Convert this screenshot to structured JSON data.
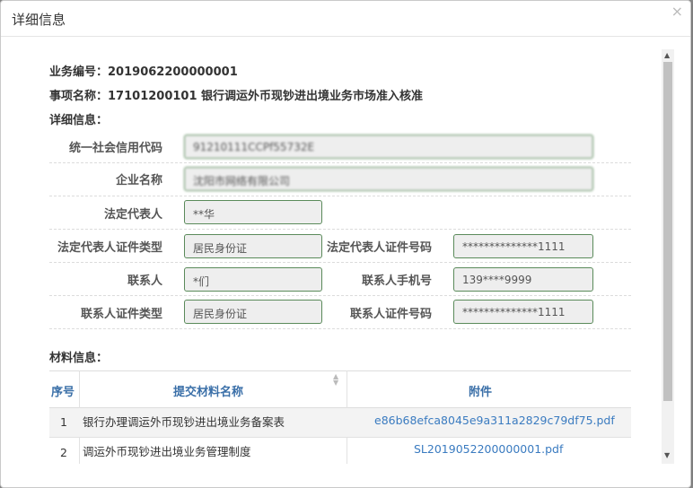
{
  "dialog": {
    "title": "详细信息",
    "close_glyph": "×"
  },
  "info": {
    "business_no_label": "业务编号：",
    "business_no": "2019062200000001",
    "item_name_label": "事项名称：",
    "item_name": "17101200101 银行调运外币现钞进出境业务市场准入核准",
    "details_label": "详细信息："
  },
  "form": {
    "credit_code_label": "统一社会信用代码",
    "credit_code_value": "91210111CCPf55732E",
    "company_name_label": "企业名称",
    "company_name_value": "沈阳市网络有限公司",
    "legal_rep_label": "法定代表人",
    "legal_rep_value": "**华",
    "legal_id_type_label": "法定代表人证件类型",
    "legal_id_type_value": "居民身份证",
    "legal_id_no_label": "法定代表人证件号码",
    "legal_id_no_value": "**************1111",
    "contact_label": "联系人",
    "contact_value": "*们",
    "contact_phone_label": "联系人手机号",
    "contact_phone_value": "139****9999",
    "contact_id_type_label": "联系人证件类型",
    "contact_id_type_value": "居民身份证",
    "contact_id_no_label": "联系人证件号码",
    "contact_id_no_value": "**************1111"
  },
  "materials": {
    "label": "材料信息：",
    "headers": {
      "seq": "序号",
      "name": "提交材料名称",
      "attachment": "附件"
    },
    "rows": [
      {
        "seq": "1",
        "name": "银行办理调运外币现钞进出境业务备案表",
        "file": "e86b68efca8045e9a311a2829c79df75.pdf"
      },
      {
        "seq": "2",
        "name": "调运外币现钞进出境业务管理制度",
        "file": "SL2019052200000001.pdf"
      }
    ]
  }
}
